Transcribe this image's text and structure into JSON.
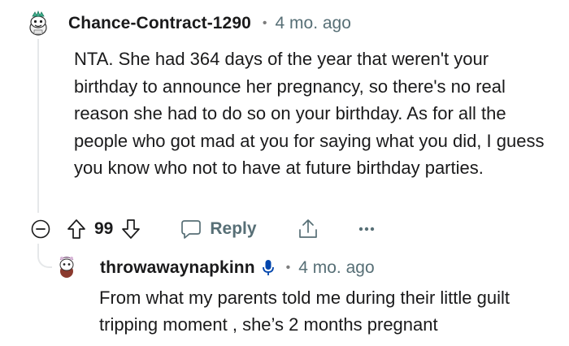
{
  "comments": [
    {
      "username": "Chance-Contract-1290",
      "separator": "•",
      "time": "4 mo. ago",
      "avatar_icon": "snoo-avatar",
      "body": "NTA. She had 364 days of the year that weren't your birthday to announce her pregnancy, so there's no real reason she had to do so on your birthday. As for all the people who got mad at you for saying what you did, I guess you know who not to have at future birthday parties.",
      "actions": {
        "score": "99",
        "reply_label": "Reply",
        "icons": [
          "collapse-icon",
          "upvote-icon",
          "downvote-icon",
          "comment-icon",
          "share-icon",
          "more-icon"
        ]
      }
    },
    {
      "username": "throwawaynapkinn",
      "separator": "•",
      "time": "4 mo. ago",
      "avatar_icon": "snoo-avatar",
      "badge_icon": "microphone-icon",
      "body": "From what my parents told me during their little guilt tripping moment , she’s 2 months pregnant"
    }
  ],
  "colors": {
    "text": "#1a1a1b",
    "meta": "#576f76",
    "thread_line": "#e6e8ea",
    "mic_badge": "#0045ac"
  }
}
